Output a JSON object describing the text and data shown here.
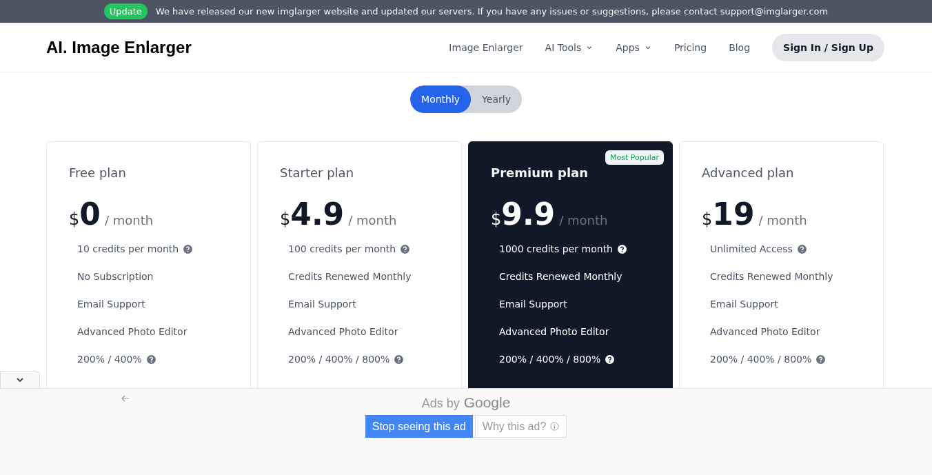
{
  "announcement": {
    "badge": "Update",
    "message": "We have released our new imglarger website and updated our servers. If you have any issues or suggestions, please contact support@imglarger.com"
  },
  "header": {
    "logo": "AI. Image Enlarger",
    "nav": [
      {
        "label": "Image Enlarger",
        "dropdown": false
      },
      {
        "label": "AI Tools",
        "dropdown": true
      },
      {
        "label": "Apps",
        "dropdown": true
      },
      {
        "label": "Pricing",
        "dropdown": false
      },
      {
        "label": "Blog",
        "dropdown": false
      }
    ],
    "sign_in": "Sign In / Sign Up"
  },
  "billing_toggle": [
    {
      "label": "Monthly",
      "selected": true
    },
    {
      "label": "Yearly",
      "selected": false
    }
  ],
  "plans": [
    {
      "name": "Free plan",
      "currency": "$",
      "price": "0",
      "period": "/ month",
      "featured": false,
      "features": [
        {
          "text": "10 credits per month",
          "help": true
        },
        {
          "text": "No Subscription",
          "help": false
        },
        {
          "text": "Email Support",
          "help": false
        },
        {
          "text": "Advanced Photo Editor",
          "help": false
        },
        {
          "text": "200% / 400%",
          "help": true
        }
      ]
    },
    {
      "name": "Starter plan",
      "currency": "$",
      "price": "4.9",
      "period": "/ month",
      "featured": false,
      "features": [
        {
          "text": "100 credits per month",
          "help": true
        },
        {
          "text": "Credits Renewed Monthly",
          "help": false
        },
        {
          "text": "Email Support",
          "help": false
        },
        {
          "text": "Advanced Photo Editor",
          "help": false
        },
        {
          "text": "200% / 400% / 800%",
          "help": true
        }
      ]
    },
    {
      "name": "Premium plan",
      "currency": "$",
      "price": "9.9",
      "period": "/ month",
      "featured": true,
      "badge": "Most Popular",
      "features": [
        {
          "text": "1000 credits per month",
          "help": true
        },
        {
          "text": "Credits Renewed Monthly",
          "help": false
        },
        {
          "text": "Email Support",
          "help": false
        },
        {
          "text": "Advanced Photo Editor",
          "help": false
        },
        {
          "text": "200% / 400% / 800%",
          "help": true
        }
      ]
    },
    {
      "name": "Advanced plan",
      "currency": "$",
      "price": "19",
      "period": "/ month",
      "featured": false,
      "features": [
        {
          "text": "Unlimited Access",
          "help": true
        },
        {
          "text": "Credits Renewed Monthly",
          "help": false
        },
        {
          "text": "Email Support",
          "help": false
        },
        {
          "text": "Advanced Photo Editor",
          "help": false
        },
        {
          "text": "200% / 400% / 800%",
          "help": true
        }
      ]
    }
  ],
  "ad": {
    "ads_by": "Ads by",
    "brand": "Google",
    "stop_button": "Stop seeing this ad",
    "why_button": "Why this ad?"
  }
}
